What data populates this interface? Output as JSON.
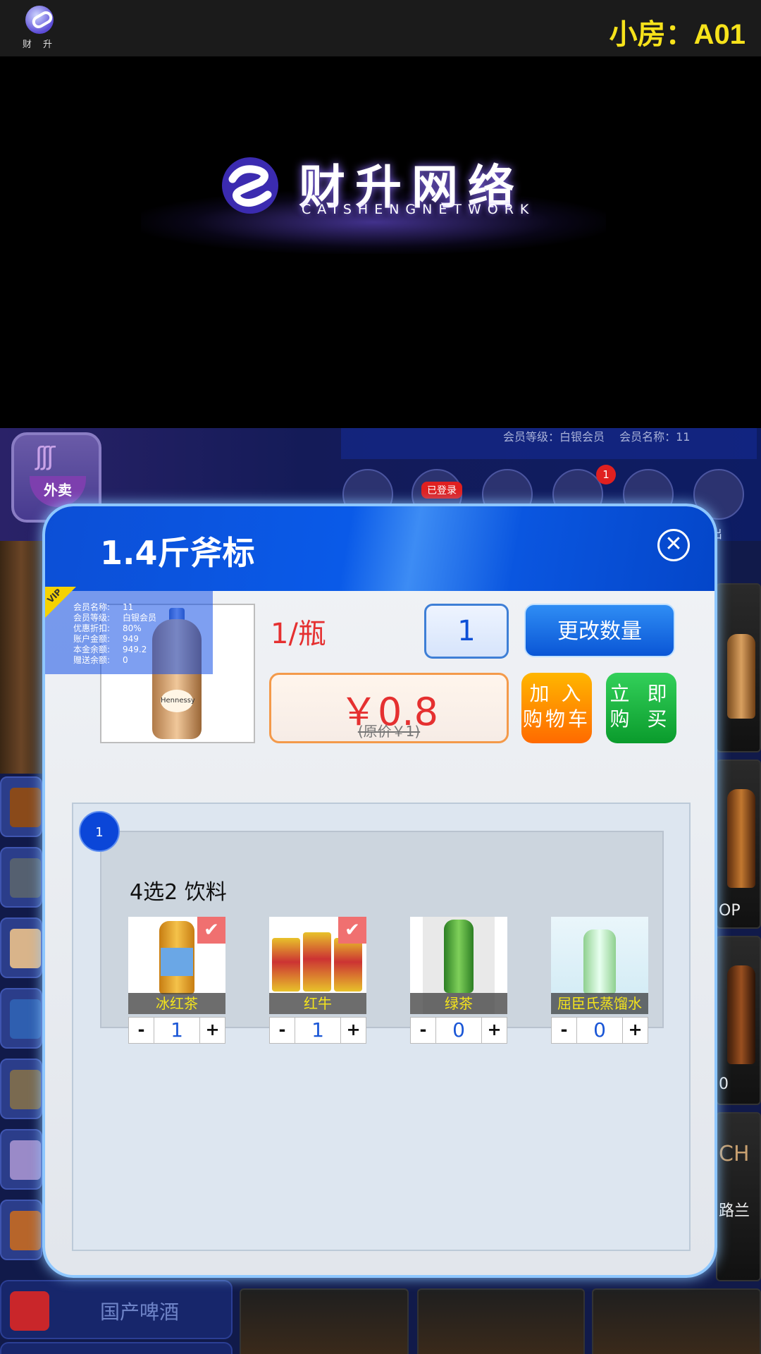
{
  "top_bar": {
    "logo_text": "财 升",
    "room_label": "小房：A01"
  },
  "banner": {
    "title": "财升网络",
    "subtitle": "CAISHENGNETWORK"
  },
  "app": {
    "takeout_label": "外卖",
    "member_strip": "会员等级：白银会员　 会员名称：11",
    "login_badge": "已登录",
    "cart_count": "1",
    "exit_label": "出",
    "beer_tab_label": "国产啤酒",
    "right_labels": [
      "OP",
      "0",
      "CH",
      "路兰"
    ]
  },
  "modal": {
    "title": "1.4斤斧标",
    "close_icon": "close-icon",
    "vip_tag": "VIP",
    "member_info": [
      {
        "key": "会员名称:",
        "value": "11"
      },
      {
        "key": "会员等级:",
        "value": "白银会员"
      },
      {
        "key": "优惠折扣:",
        "value": "80%"
      },
      {
        "key": "账户金额:",
        "value": "949"
      },
      {
        "key": "本金余额:",
        "value": "949.2"
      },
      {
        "key": "赠送余额:",
        "value": "0"
      }
    ],
    "product_label": "Hennessy",
    "unit": "1/瓶",
    "quantity": "1",
    "change_qty_label": "更改数量",
    "price_now": "￥0.8",
    "price_original": "(原价￥1)",
    "add_cart_label_1": "加 入",
    "add_cart_label_2": "购物车",
    "buy_now_label_1": "立 即",
    "buy_now_label_2": "购 买",
    "option_group": {
      "number": "1",
      "title": "4选2  饮料",
      "items": [
        {
          "name": "冰红茶",
          "qty": "1",
          "checked": true,
          "color": "#f2b93b"
        },
        {
          "name": "红牛",
          "qty": "1",
          "checked": true,
          "color": "#e8c22a"
        },
        {
          "name": "绿茶",
          "qty": "0",
          "checked": false,
          "color": "#3fae3a"
        },
        {
          "name": "屈臣氏蒸馏水",
          "qty": "0",
          "checked": false,
          "color": "#9ed8a0"
        }
      ]
    },
    "colors": {
      "header_blue": "#0c4fd6",
      "price_red": "#e53030",
      "cart_orange": "#ff6a00",
      "buy_green": "#0a9b2c"
    }
  }
}
